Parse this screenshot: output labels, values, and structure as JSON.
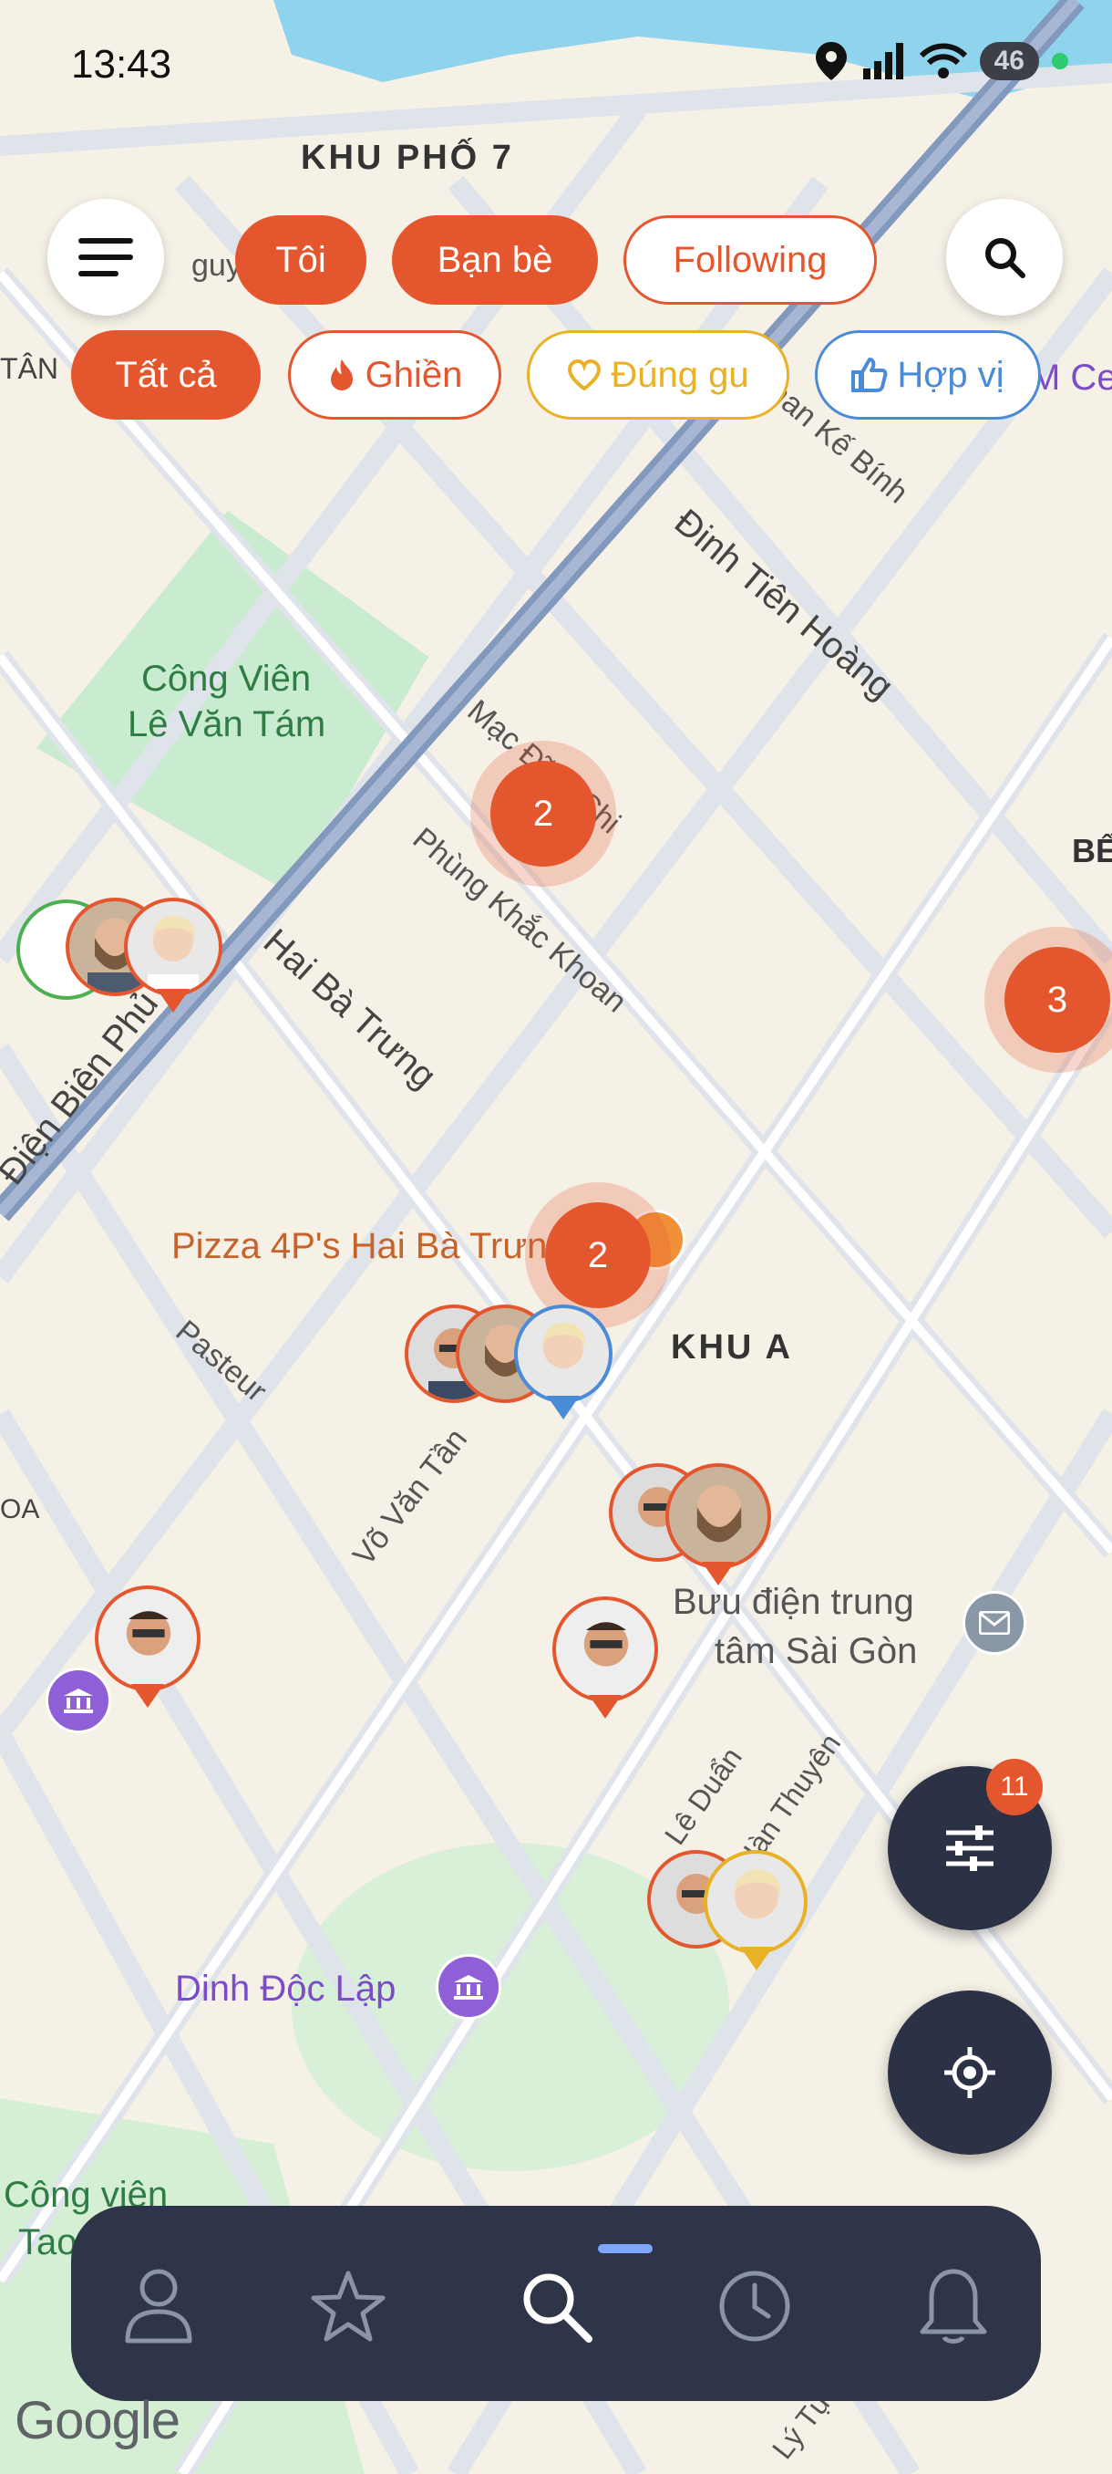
{
  "status_bar": {
    "time": "13:43",
    "battery": "46"
  },
  "filters_row1": [
    "Tôi",
    "Bạn bè",
    "Following"
  ],
  "filters_row2": {
    "all": "Tất cả",
    "ghien": "Ghiền",
    "dung_gu": "Đúng gu",
    "hop_vi": "Hợp vị"
  },
  "map_labels": {
    "khu_pho_7": "KHU PHỐ 7",
    "cong_vien_1": "Công Viên",
    "cong_vien_2": "Lê Văn Tám",
    "hai_ba_trung": "Hai Bà Trưng",
    "dinh_tien_hoang": "Đinh Tiên Hoàng",
    "mac_dinh_chi": "Mạc Đĩnh Chi",
    "phung_khac_khoan": "Phùng Khắc Khoan",
    "pizza": "Pizza 4P's Hai Bà Trưng",
    "khu_a": "KHU A",
    "pasteur": "Pasteur",
    "vo_van_tan": "Võ Văn Tần",
    "buu_dien_1": "Bưu điện trung",
    "buu_dien_2": "tâm Sài Gòn",
    "le_duan": "Lê Duẩn",
    "dinh_doc_lap": "Dinh Độc Lập",
    "tao_dan_1": "Công viên",
    "tao_dan_2": "Tao Đàn",
    "dien_bien_phu": "Điện Biên Phủ",
    "tan": "TÂN",
    "be": "BẾ",
    "nguyen": "guyễn",
    "han_ke_binh": "han Kế Bính",
    "m_ce": "M Ce",
    "oa": "OA",
    "ly_tu_trong": "Lý Tự Trọng",
    "han_thuyen": "Hàn Thuyên"
  },
  "clusters": [
    "2",
    "3",
    "2"
  ],
  "fab": {
    "filter_badge": "11"
  },
  "google_attr": "Google",
  "colors": {
    "accent": "#e4572e",
    "navy": "#2f3549",
    "yellow": "#e8b126",
    "blue": "#4a8bd7",
    "park": "#c9ebcf"
  }
}
